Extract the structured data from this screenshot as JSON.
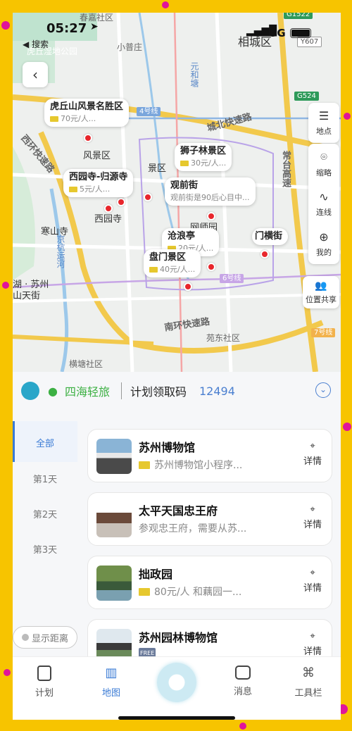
{
  "status_bar": {
    "time": "05:27",
    "signal": "5G",
    "back_app": "◀ 搜索"
  },
  "map": {
    "labels": [
      "春嘉社区",
      "虎丘湿地公园",
      "小普庄",
      "相城区",
      "元和塘",
      "城北快速路",
      "西环快速路",
      "常台高速",
      "寒山寺",
      "京杭运河",
      "湖 · 苏州",
      "山天街",
      "南环快速路",
      "苑东社区",
      "横塘社区",
      "西园寺"
    ],
    "shields": [
      "G1522",
      "Y607",
      "G524",
      "4号线",
      "6号线",
      "7号线"
    ],
    "poi_popups": [
      {
        "title": "虎丘山风景名胜区",
        "sub": "70元/人..."
      },
      {
        "title": "西园寺-归源寺",
        "sub": "5元/人..."
      },
      {
        "title": "狮子林景区",
        "sub": "30元/人..."
      },
      {
        "title": "观前街",
        "sub": "观前街是90后心目中..."
      },
      {
        "title": "沧浪亭",
        "sub": "20元/人..."
      },
      {
        "title": "盘门景区",
        "sub": "40元/人..."
      },
      {
        "title": "门横街",
        "sub": ""
      }
    ],
    "partial_labels": [
      "风景区",
      "景区",
      "网师园"
    ],
    "side_tools": [
      {
        "label": "地点",
        "icon": "list-icon"
      },
      {
        "label": "缩略",
        "icon": "pin-icon"
      },
      {
        "label": "连线",
        "icon": "route-icon"
      },
      {
        "label": "我的",
        "icon": "locate-icon"
      }
    ],
    "share_label": "位置共享"
  },
  "sheet": {
    "brand": "四海轻旅",
    "code_label": "计划领取码",
    "code_value": "12494",
    "day_tabs": [
      "全部",
      "第1天",
      "第2天",
      "第3天"
    ],
    "distance_toggle": "显示距离",
    "items": [
      {
        "name": "苏州博物馆",
        "desc": "苏州博物馆小程序...",
        "detail": "详情",
        "badge": "ticket"
      },
      {
        "name": "太平天国忠王府",
        "desc": "参观忠王府，需要从苏...",
        "detail": "详情",
        "badge": ""
      },
      {
        "name": "拙政园",
        "desc": "80元/人 和藕园一...",
        "detail": "详情",
        "badge": "ticket"
      },
      {
        "name": "苏州园林博物馆",
        "desc": "",
        "detail": "详情",
        "badge": "FREE"
      }
    ]
  },
  "tabbar": {
    "items": [
      "计划",
      "地图",
      "消息",
      "工具栏"
    ],
    "active": "地图"
  },
  "colors": {
    "accent": "#2aa6c9",
    "marker": "#e8262c",
    "frame": "#f7c400",
    "active_tab": "#3a7bd5"
  }
}
